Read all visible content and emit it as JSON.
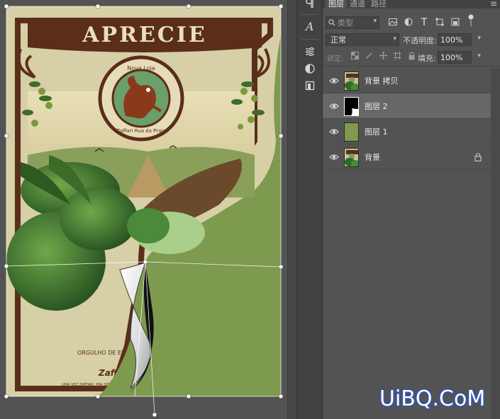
{
  "canvas": {
    "poster_title": "APRECIE",
    "badge_top": "Nova Loja",
    "badge_bottom": "Zaffari Rua da Praia",
    "bottom_text": "ORGULHO DE ESTAR AQUI",
    "brand": "Zaffari",
    "small_text": "UMA VEZ ZAFFARI, PRA SEMPRE",
    "background_color": "#7d9a4e"
  },
  "panel": {
    "tabs": [
      {
        "label": "图层",
        "active": true
      },
      {
        "label": "通道",
        "active": false
      },
      {
        "label": "路径",
        "active": false
      }
    ],
    "menu_icon": "hamburger-icon",
    "filter_placeholder": "类型",
    "blend_mode": "正常",
    "opacity_label": "不透明度:",
    "opacity_value": "100%",
    "lock_label": "锁定:",
    "fill_label": "填充:",
    "fill_value": "100%"
  },
  "layers": [
    {
      "name": "背景 拷贝",
      "selected": false,
      "locked": false
    },
    {
      "name": "图层 2",
      "selected": true,
      "locked": false
    },
    {
      "name": "图层 1",
      "selected": false,
      "locked": false
    },
    {
      "name": "背景",
      "selected": false,
      "locked": true
    }
  ],
  "layer_colors": {
    "layer1_fill": "#7d9a4e",
    "selection_bg": "#676767"
  },
  "watermark": "UiBQ.CoM"
}
